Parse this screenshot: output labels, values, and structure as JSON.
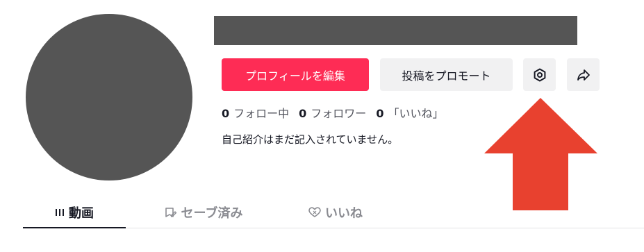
{
  "profile": {
    "edit_label": "プロフィールを編集",
    "promote_label": "投稿をプロモート"
  },
  "icons": {
    "settings": "gear-icon",
    "share": "share-icon",
    "videos_tab": "grid-icon",
    "saved_tab": "bookmark-icon",
    "liked_tab": "heart-icon"
  },
  "stats": {
    "following_count": "0",
    "following_label": "フォロー中",
    "followers_count": "0",
    "followers_label": "フォロワー",
    "likes_count": "0",
    "likes_label": "「いいね」"
  },
  "bio": "自己紹介はまだ記入されていません。",
  "tabs": [
    {
      "label": "動画",
      "active": true
    },
    {
      "label": "セーブ済み",
      "active": false
    },
    {
      "label": "いいね",
      "active": false
    }
  ],
  "colors": {
    "primary": "#fe2c55",
    "placeholder": "#555555",
    "annotation_arrow": "#e8412f"
  }
}
